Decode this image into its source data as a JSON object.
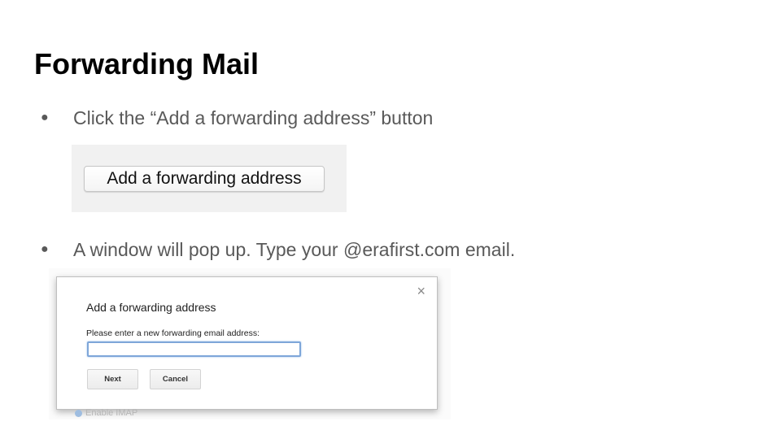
{
  "slide": {
    "title": "Forwarding Mail",
    "bullets": [
      {
        "dot": "●",
        "text": "Click the “Add a forwarding address” button"
      },
      {
        "dot": "●",
        "text": "A window will pop up. Type your @erafirst.com email."
      }
    ]
  },
  "screenshot_button": {
    "label": "Add a forwarding address"
  },
  "dialog": {
    "close_glyph": "×",
    "title": "Add a forwarding address",
    "field_label": "Please enter a new forwarding email address:",
    "field_value": "",
    "next_label": "Next",
    "cancel_label": "Cancel"
  },
  "background_settings": {
    "imap_label": "Enable IMAP"
  },
  "colors": {
    "bullet_text": "#595959",
    "title_text": "#000000",
    "input_focus_border": "#7ea6d9"
  }
}
